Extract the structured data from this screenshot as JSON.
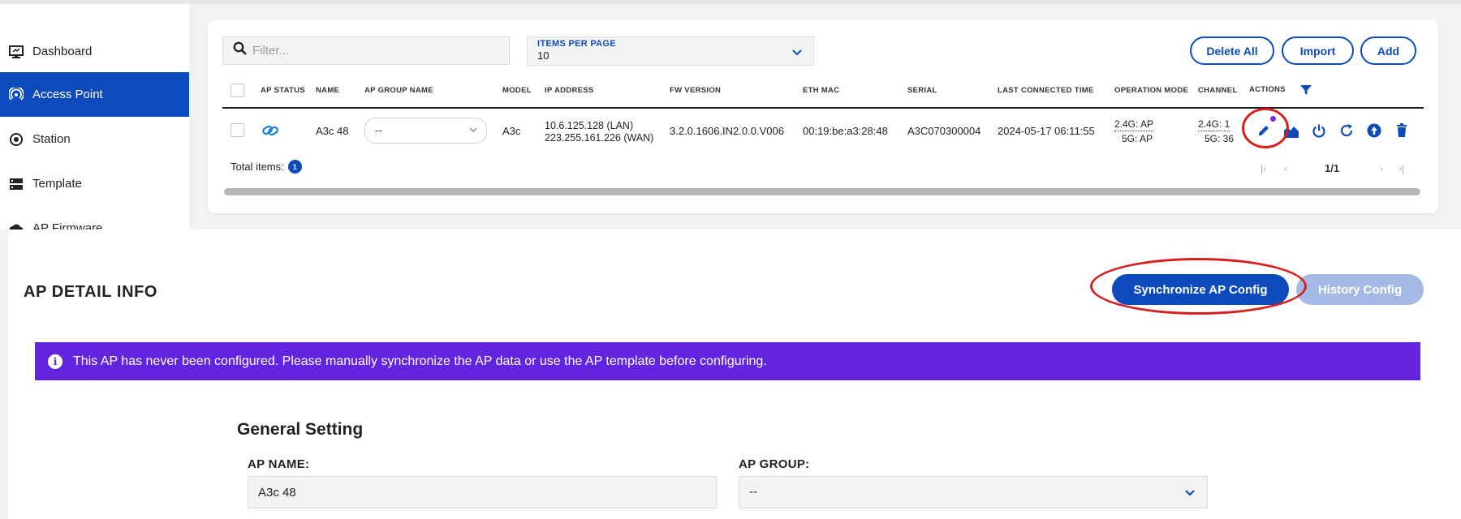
{
  "sidebar": {
    "items": [
      {
        "label": "Dashboard",
        "icon": "monitor-icon"
      },
      {
        "label": "Access Point",
        "icon": "access-point-icon",
        "active": true
      },
      {
        "label": "Station",
        "icon": "station-icon"
      },
      {
        "label": "Template",
        "icon": "template-icon"
      },
      {
        "label": "AP Firmware",
        "icon": "cloud-icon"
      }
    ]
  },
  "toolbar": {
    "filter_placeholder": "Filter...",
    "items_per_page_label": "ITEMS PER PAGE",
    "items_per_page_value": "10",
    "delete_all_label": "Delete All",
    "import_label": "Import",
    "add_label": "Add"
  },
  "table": {
    "headers": [
      "AP STATUS",
      "NAME",
      "AP GROUP NAME",
      "MODEL",
      "IP ADDRESS",
      "FW VERSION",
      "ETH MAC",
      "SERIAL",
      "LAST CONNECTED TIME",
      "OPERATION MODE",
      "CHANNEL",
      "ACTIONS"
    ],
    "rows": [
      {
        "name": "A3c 48",
        "group": "--",
        "model": "A3c",
        "ip_lan": "10.6.125.128 (LAN)",
        "ip_wan": "223.255.161.226 (WAN)",
        "fw_version": "3.2.0.1606.IN2.0.0.V006",
        "eth_mac": "00:19:be:a3:28:48",
        "serial": "A3C070300004",
        "last_connected": "2024-05-17 06:11:55",
        "op_mode_24": "2.4G: AP",
        "op_mode_5": "5G: AP",
        "channel_24": "2.4G: 1",
        "channel_5": "5G: 36"
      }
    ],
    "total_label": "Total items:",
    "total_count": "1",
    "pagination": "1/1"
  },
  "detail": {
    "title": "AP DETAIL INFO",
    "sync_label": "Synchronize AP Config",
    "history_label": "History Config",
    "banner": "This AP has never been configured. Please manually synchronize the AP data or use the AP template before configuring.",
    "section_title": "General Setting",
    "ap_name_label": "AP NAME:",
    "ap_name_value": "A3c 48",
    "ap_group_label": "AP GROUP:",
    "ap_group_value": "--"
  },
  "colors": {
    "primary": "#0d4bbd",
    "banner": "#6324e0",
    "highlight_ring": "#d62020",
    "disabled_button": "#a4b9e4"
  }
}
